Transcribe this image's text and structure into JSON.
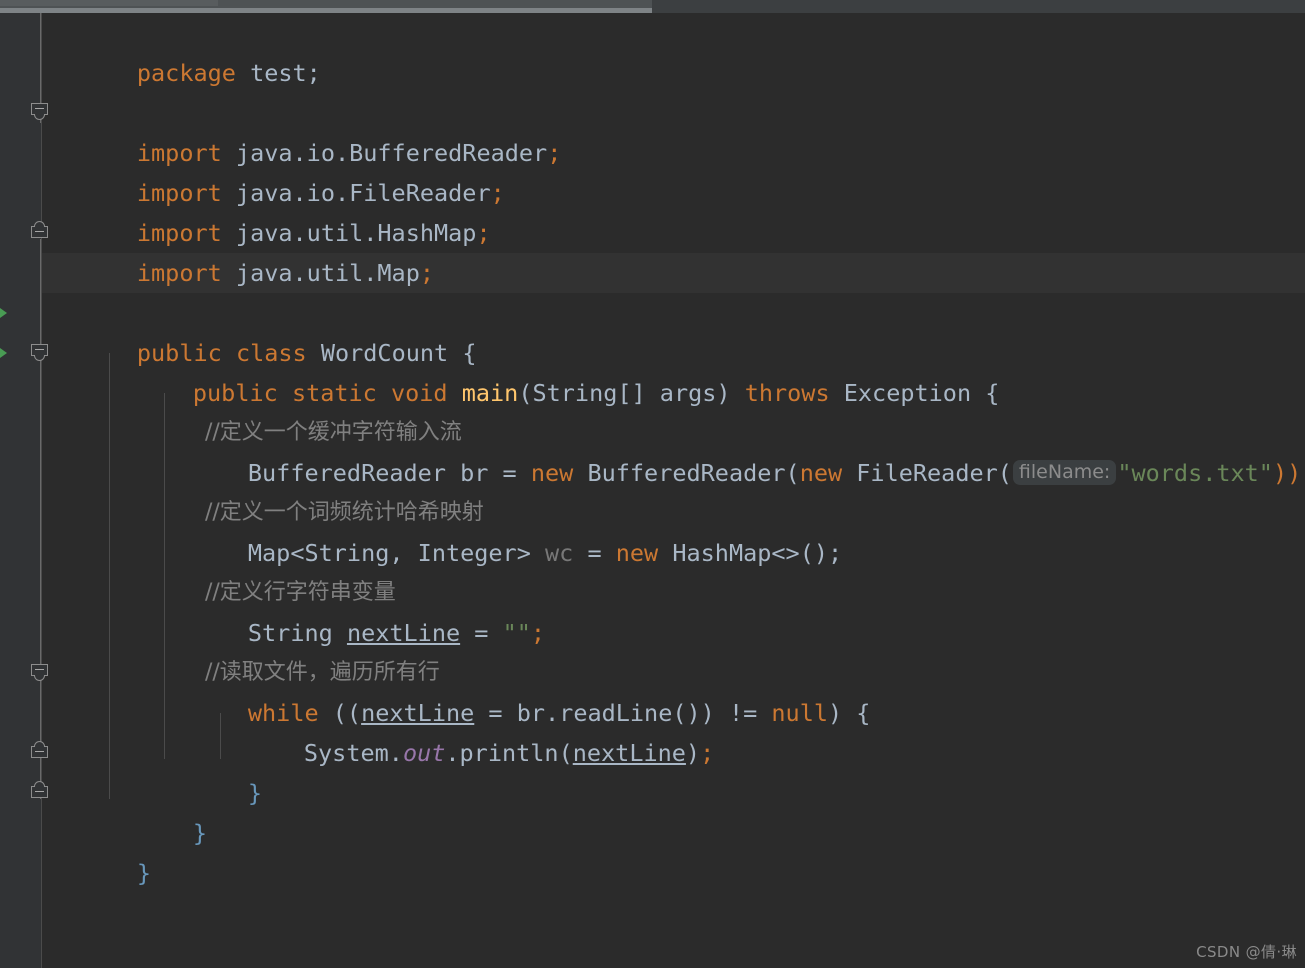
{
  "app": {
    "theme": "darcula",
    "background": "#2b2b2b",
    "gutter_background": "#313335",
    "current_line_background": "#323232",
    "keyword_color": "#cc7832",
    "string_color": "#6a8759",
    "comment_color": "#808080",
    "text_color": "#a9b7c6",
    "static_field_color": "#9876aa",
    "method_color": "#ffc66d",
    "unused_color": "#787878",
    "run_arrow_color": "#499c54"
  },
  "editor": {
    "language": "Java",
    "class_name": "WordCount",
    "lines": [
      {
        "n": 1,
        "indent": 0,
        "text": "package test;"
      },
      {
        "n": 2,
        "indent": 0,
        "text": ""
      },
      {
        "n": 3,
        "indent": 0,
        "text": "import java.io.BufferedReader;"
      },
      {
        "n": 4,
        "indent": 0,
        "text": "import java.io.FileReader;"
      },
      {
        "n": 5,
        "indent": 0,
        "text": "import java.util.HashMap;"
      },
      {
        "n": 6,
        "indent": 0,
        "text": "import java.util.Map;"
      },
      {
        "n": 7,
        "indent": 0,
        "text": ""
      },
      {
        "n": 8,
        "indent": 0,
        "text": "public class WordCount {"
      },
      {
        "n": 9,
        "indent": 1,
        "text": "public static void main(String[] args) throws Exception {"
      },
      {
        "n": 10,
        "indent": 2,
        "text": "//定义一个缓冲字符输入流"
      },
      {
        "n": 11,
        "indent": 2,
        "text": "BufferedReader br = new BufferedReader(new FileReader( fileName: \"words.txt\"));"
      },
      {
        "n": 12,
        "indent": 2,
        "text": "//定义一个词频统计哈希映射"
      },
      {
        "n": 13,
        "indent": 2,
        "text": "Map<String, Integer> wc = new HashMap<>();"
      },
      {
        "n": 14,
        "indent": 2,
        "text": "//定义行字符串变量"
      },
      {
        "n": 15,
        "indent": 2,
        "text": "String nextLine = \"\";"
      },
      {
        "n": 16,
        "indent": 2,
        "text": "//读取文件，遍历所有行"
      },
      {
        "n": 17,
        "indent": 2,
        "text": "while ((nextLine = br.readLine()) != null) {"
      },
      {
        "n": 18,
        "indent": 3,
        "text": "System.out.println(nextLine);"
      },
      {
        "n": 19,
        "indent": 2,
        "text": "}"
      },
      {
        "n": 20,
        "indent": 1,
        "text": "}"
      },
      {
        "n": 21,
        "indent": 0,
        "text": "}"
      }
    ],
    "tokens": {
      "kw_package": "package",
      "kw_import": "import",
      "kw_public": "public",
      "kw_class": "class",
      "kw_static": "static",
      "kw_void": "void",
      "kw_new": "new",
      "kw_throws": "throws",
      "kw_while": "while",
      "kw_null": "null",
      "pkg_test": " test;",
      "imp_bufferedreader": " java.io.BufferedReader",
      "imp_filereader": " java.io.FileReader",
      "imp_hashmap": " java.util.HashMap",
      "imp_map": " java.util.Map",
      "semi": ";",
      "class_name": " WordCount {",
      "main_name": "main",
      "main_sig_pre": " ",
      "main_args": "(String[] args)",
      "exception": " Exception {",
      "comment_1": "//定义一个缓冲字符输入流",
      "comment_2": "//定义一个词频统计哈希映射",
      "comment_3": "//定义行字符串变量",
      "comment_4": "//读取文件，遍历所有行",
      "br_decl_pre": "BufferedReader br = ",
      "br_decl_ctor": " BufferedReader(",
      "br_decl_new2": "new",
      "br_decl_filereader": " FileReader(",
      "param_hint_filename": "fileName:",
      "str_words_txt": "\"words.txt\"",
      "br_decl_tail": "));",
      "map_decl_type": "Map<String, Integer> ",
      "map_decl_var": "wc",
      "map_decl_eq": " = ",
      "map_decl_ctor": " HashMap<>();",
      "str_decl_type": "String ",
      "str_decl_var": "nextLine",
      "str_decl_eq": " = ",
      "str_decl_empty": "\"\"",
      "while_open": " ((",
      "while_var": "nextLine",
      "while_mid": " = br.readLine()) != ",
      "while_tail": ") {",
      "sysout_system": "System.",
      "sysout_out": "out",
      "sysout_println": ".println(",
      "sysout_arg": "nextLine",
      "sysout_tail": ");",
      "brace_close": "}"
    }
  },
  "watermark": {
    "text": "CSDN @倩·琳"
  }
}
